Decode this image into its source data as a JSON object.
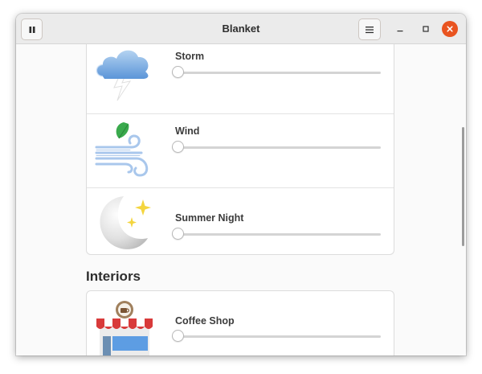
{
  "window": {
    "title": "Blanket"
  },
  "header": {
    "play_pause_icon": "pause-icon",
    "menu_icon": "hamburger-menu-icon",
    "controls": [
      "minimize-icon",
      "maximize-icon",
      "close-icon"
    ]
  },
  "sounds": [
    {
      "label": "Storm",
      "icon": "storm-cloud-icon",
      "volume": 0
    },
    {
      "label": "Wind",
      "icon": "wind-icon",
      "volume": 0
    },
    {
      "label": "Summer Night",
      "icon": "moon-stars-icon",
      "volume": 0
    }
  ],
  "interiors": {
    "section_title": "Interiors",
    "sounds": [
      {
        "label": "Coffee Shop",
        "icon": "coffee-shop-icon",
        "volume": 0
      }
    ]
  },
  "colors": {
    "accent_close": "#e95420",
    "titlebar": "#ebebeb",
    "background": "#fafafa"
  }
}
